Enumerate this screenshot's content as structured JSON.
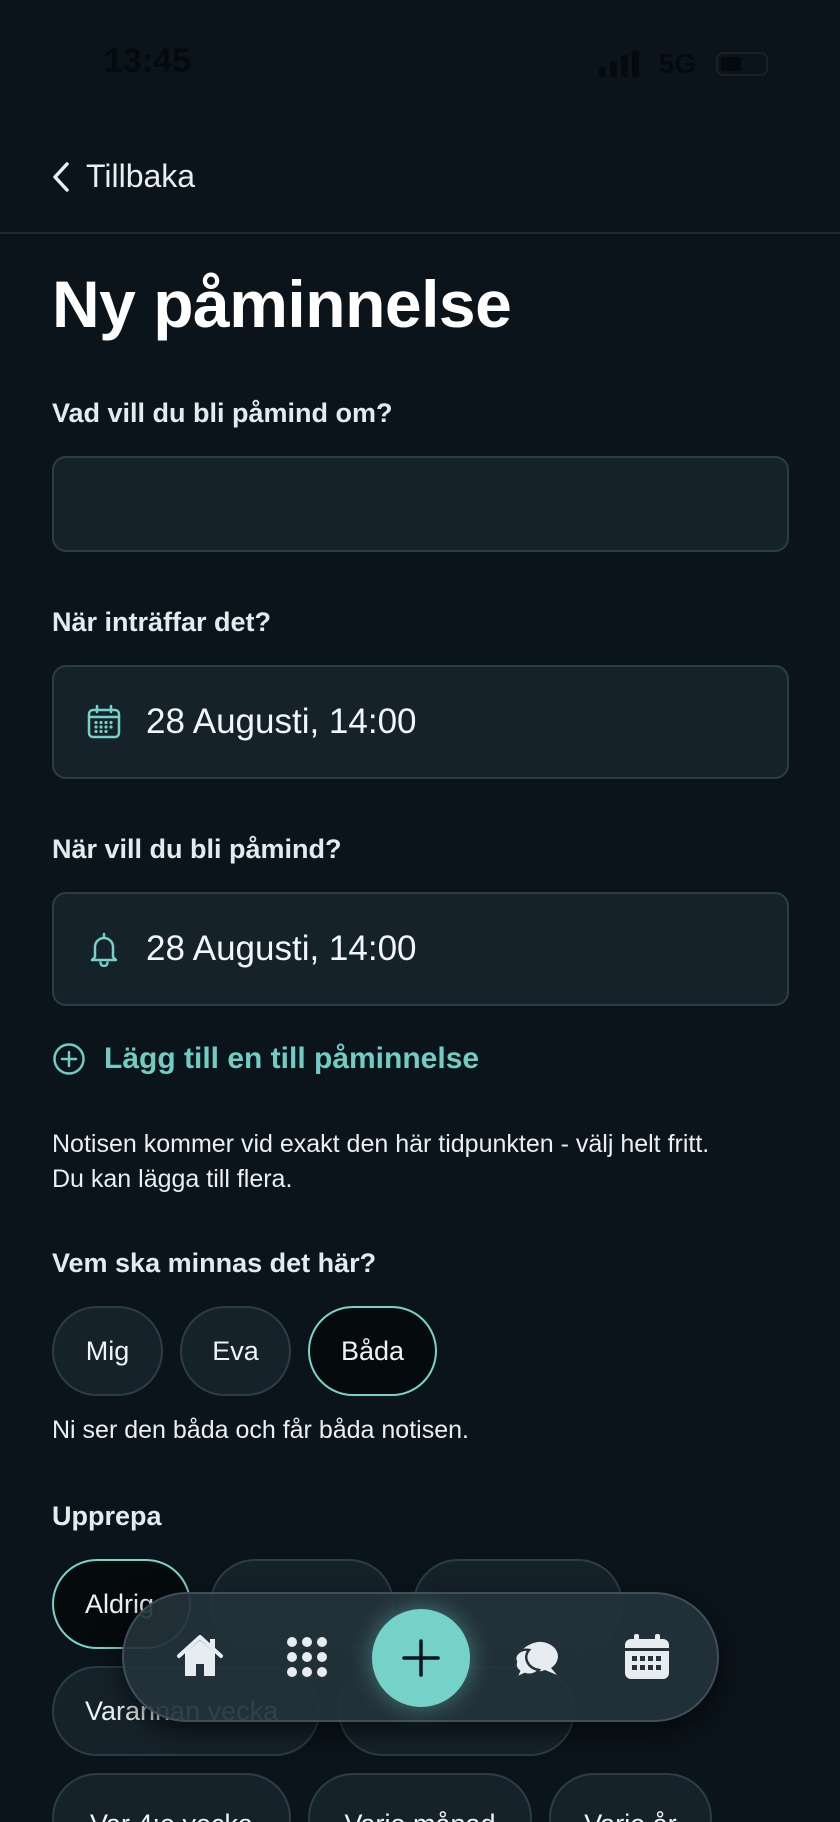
{
  "status_bar": {
    "time": "13:45",
    "network": "5G"
  },
  "header": {
    "back_label": "Tillbaka"
  },
  "page": {
    "title": "Ny påminnelse"
  },
  "form": {
    "what_label": "Vad vill du bli påmind om?",
    "what_value": "",
    "when_label": "När inträffar det?",
    "when_value": "28 Augusti, 14:00",
    "remind_label": "När vill du bli påmind?",
    "remind_value": "28 Augusti, 14:00",
    "add_reminder_label": "Lägg till en till påminnelse",
    "helper_line1": "Notisen kommer vid exakt den här tidpunkten - välj helt fritt.",
    "helper_line2": "Du kan lägga till flera.",
    "who_label": "Vem ska minnas det här?",
    "who_options": [
      "Mig",
      "Eva",
      "Båda"
    ],
    "who_selected": "Båda",
    "who_helper": "Ni ser den båda och får båda notisen.",
    "repeat_label": "Upprepa",
    "repeat_options_visible": [
      "Aldrig",
      "Varannan vecka",
      "Var 4:e vecka",
      "Varje månad",
      "Varje år"
    ],
    "repeat_selected": "Aldrig"
  },
  "colors": {
    "background": "#0b141b",
    "accent": "#74d2c8",
    "field_bg": "#16222a",
    "field_border": "#2b3d47"
  },
  "bottom_nav": {
    "items": [
      "home-icon",
      "apps-grid-icon",
      "add-icon",
      "chat-icon",
      "calendar-icon"
    ]
  }
}
